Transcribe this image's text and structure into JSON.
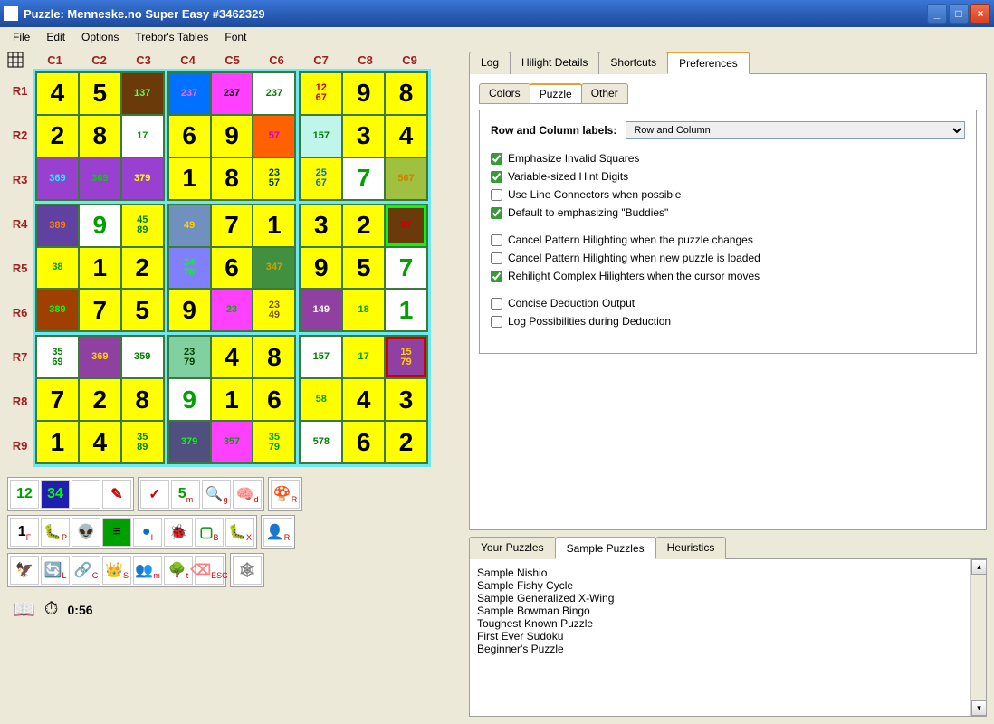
{
  "window": {
    "title": "Puzzle: Menneske.no Super Easy #3462329"
  },
  "menu": [
    "File",
    "Edit",
    "Options",
    "Trebor's Tables",
    "Font"
  ],
  "cols": [
    "C1",
    "C2",
    "C3",
    "C4",
    "C5",
    "C6",
    "C7",
    "C8",
    "C9"
  ],
  "rows": [
    "R1",
    "R2",
    "R3",
    "R4",
    "R5",
    "R6",
    "R7",
    "R8",
    "R9"
  ],
  "grid": [
    [
      {
        "t": "4",
        "bg": "#ffff00"
      },
      {
        "t": "5",
        "bg": "#ffff00"
      },
      {
        "t": "137",
        "bg": "#6a3a0a",
        "fg": "#5cff5c",
        "hint": true
      },
      {
        "t": "237",
        "bg": "#0070ff",
        "fg": "#ff60ff",
        "hint": true
      },
      {
        "t": "237",
        "bg": "#ff40ff",
        "fg": "#000",
        "hint": true
      },
      {
        "t": "237",
        "bg": "#ffffff",
        "fg": "#008000",
        "hint": true
      },
      {
        "t": "12\n67",
        "bg": "#ffff00",
        "fg": "#d00000",
        "hint": true
      },
      {
        "t": "9",
        "bg": "#ffff00"
      },
      {
        "t": "8",
        "bg": "#ffff00"
      }
    ],
    [
      {
        "t": "2",
        "bg": "#ffff00"
      },
      {
        "t": "8",
        "bg": "#ffff00"
      },
      {
        "t": "17",
        "bg": "#ffffff",
        "fg": "#00a000",
        "hint": true
      },
      {
        "t": "6",
        "bg": "#ffff00"
      },
      {
        "t": "9",
        "bg": "#ffff00"
      },
      {
        "t": "57",
        "bg": "#ff6000",
        "fg": "#d000d0",
        "hint": true
      },
      {
        "t": "157",
        "bg": "#c0f5ec",
        "fg": "#008000",
        "hint": true
      },
      {
        "t": "3",
        "bg": "#ffff00"
      },
      {
        "t": "4",
        "bg": "#ffff00"
      }
    ],
    [
      {
        "t": "369",
        "bg": "#9a40d0",
        "fg": "#00ffff",
        "hint": true
      },
      {
        "t": "369",
        "bg": "#9a40d0",
        "fg": "#00d000",
        "hint": true
      },
      {
        "t": "379",
        "bg": "#9a40d0",
        "fg": "#ffff00",
        "hint": true
      },
      {
        "t": "1",
        "bg": "#ffff00"
      },
      {
        "t": "8",
        "bg": "#ffff00"
      },
      {
        "t": "23\n57",
        "bg": "#ffff00",
        "fg": "#004000",
        "hint": true
      },
      {
        "t": "25\n67",
        "bg": "#ffff00",
        "fg": "#0070d0",
        "hint": true
      },
      {
        "t": "7",
        "bg": "#ffffff",
        "fg": "#00a000"
      },
      {
        "t": "567",
        "bg": "#a0c040",
        "fg": "#d08000",
        "hint": true
      }
    ],
    [
      {
        "t": "389",
        "bg": "#6040a0",
        "fg": "#ff8000",
        "hint": true
      },
      {
        "t": "9",
        "bg": "#ffffff",
        "fg": "#00a000"
      },
      {
        "t": "45\n89",
        "bg": "#ffff00",
        "fg": "#008000",
        "hint": true
      },
      {
        "t": "49",
        "bg": "#7090c0",
        "fg": "#ffd000",
        "hint": true
      },
      {
        "t": "7",
        "bg": "#ffff00"
      },
      {
        "t": "1",
        "bg": "#ffff00"
      },
      {
        "t": "3",
        "bg": "#ffff00"
      },
      {
        "t": "2",
        "bg": "#ffff00"
      },
      {
        "t": "67",
        "bg": "#6a3a0a",
        "fg": "#d00000",
        "hint": true,
        "accent": "#00ff00"
      }
    ],
    [
      {
        "t": "38",
        "bg": "#ffff00",
        "fg": "#00a000",
        "hint": true
      },
      {
        "t": "1",
        "bg": "#ffff00"
      },
      {
        "t": "2",
        "bg": "#ffff00"
      },
      {
        "t": "34\n78",
        "bg": "#8080ff",
        "fg": "#00ff00",
        "hint": true
      },
      {
        "t": "6",
        "bg": "#ffff00"
      },
      {
        "t": "347",
        "bg": "#409040",
        "fg": "#d0a000",
        "hint": true
      },
      {
        "t": "9",
        "bg": "#ffff00"
      },
      {
        "t": "5",
        "bg": "#ffff00"
      },
      {
        "t": "7",
        "bg": "#ffffff",
        "fg": "#00a000"
      }
    ],
    [
      {
        "t": "389",
        "bg": "#a04000",
        "fg": "#00ff00",
        "hint": true
      },
      {
        "t": "7",
        "bg": "#ffff00"
      },
      {
        "t": "5",
        "bg": "#ffff00"
      },
      {
        "t": "9",
        "bg": "#ffff00"
      },
      {
        "t": "23",
        "bg": "#ff40ff",
        "fg": "#00b000",
        "hint": true
      },
      {
        "t": "23\n49",
        "bg": "#ffff00",
        "fg": "#805000",
        "hint": true
      },
      {
        "t": "149",
        "bg": "#9040a0",
        "fg": "#ffffff",
        "hint": true
      },
      {
        "t": "18",
        "bg": "#ffff00",
        "fg": "#00a000",
        "hint": true
      },
      {
        "t": "1",
        "bg": "#ffffff",
        "fg": "#00a000"
      }
    ],
    [
      {
        "t": "35\n69",
        "bg": "#ffffff",
        "fg": "#008000",
        "hint": true
      },
      {
        "t": "369",
        "bg": "#9040a0",
        "fg": "#ffd000",
        "hint": true
      },
      {
        "t": "359",
        "bg": "#ffffff",
        "fg": "#008000",
        "hint": true
      },
      {
        "t": "23\n79",
        "bg": "#80d0a0",
        "fg": "#004000",
        "hint": true
      },
      {
        "t": "4",
        "bg": "#ffff00"
      },
      {
        "t": "8",
        "bg": "#ffff00"
      },
      {
        "t": "157",
        "bg": "#ffffff",
        "fg": "#008000",
        "hint": true
      },
      {
        "t": "17",
        "bg": "#ffff00",
        "fg": "#00a000",
        "hint": true
      },
      {
        "t": "15\n79",
        "bg": "#9040a0",
        "fg": "#ffd000",
        "hint": true,
        "accent": "#d00000"
      }
    ],
    [
      {
        "t": "7",
        "bg": "#ffff00"
      },
      {
        "t": "2",
        "bg": "#ffff00"
      },
      {
        "t": "8",
        "bg": "#ffff00"
      },
      {
        "t": "9",
        "bg": "#ffffff",
        "fg": "#00a000"
      },
      {
        "t": "1",
        "bg": "#ffff00"
      },
      {
        "t": "6",
        "bg": "#ffff00"
      },
      {
        "t": "58",
        "bg": "#ffff00",
        "fg": "#00a000",
        "hint": true
      },
      {
        "t": "4",
        "bg": "#ffff00"
      },
      {
        "t": "3",
        "bg": "#ffff00"
      }
    ],
    [
      {
        "t": "1",
        "bg": "#ffff00"
      },
      {
        "t": "4",
        "bg": "#ffff00"
      },
      {
        "t": "35\n89",
        "bg": "#ffff00",
        "fg": "#008000",
        "hint": true
      },
      {
        "t": "379",
        "bg": "#505080",
        "fg": "#00ff00",
        "hint": true
      },
      {
        "t": "357",
        "bg": "#ff40ff",
        "fg": "#00a000",
        "hint": true
      },
      {
        "t": "35\n79",
        "bg": "#ffff00",
        "fg": "#00a000",
        "hint": true
      },
      {
        "t": "578",
        "bg": "#ffffff",
        "fg": "#008000",
        "hint": true
      },
      {
        "t": "6",
        "bg": "#ffff00"
      },
      {
        "t": "2",
        "bg": "#ffff00"
      }
    ]
  ],
  "toolbar1": [
    {
      "txt": "12",
      "bg": "#ffffff",
      "fg": "#00a000"
    },
    {
      "txt": "34",
      "bg": "#2020b0",
      "fg": "#00ff00"
    },
    {
      "txt": "",
      "bg": "#ffffff"
    },
    {
      "txt": "✎",
      "bg": "#ffffff",
      "fg": "#d00000"
    }
  ],
  "toolbar1b": [
    {
      "txt": "✓",
      "fg": "#d00000"
    },
    {
      "txt": "5",
      "fg": "#00a000",
      "sub": "m"
    },
    {
      "txt": "🔍",
      "fg": "#d00000",
      "sub": "g"
    },
    {
      "txt": "🧠",
      "fg": "#e0a0b0",
      "sub": "d"
    }
  ],
  "toolbar1c": [
    {
      "txt": "🍄",
      "fg": "#3080d0",
      "sub": "R"
    }
  ],
  "toolbar2": [
    {
      "txt": "1",
      "sub": "F"
    },
    {
      "txt": "🐛",
      "fg": "#00a000",
      "sub": "P"
    },
    {
      "txt": "👽",
      "fg": "#00a000"
    },
    {
      "txt": "≡",
      "bg": "#00a000",
      "fg": "#000"
    },
    {
      "txt": "●",
      "fg": "#0070d0",
      "sub": "I"
    },
    {
      "txt": "🐞"
    },
    {
      "txt": "▢",
      "fg": "#00a000",
      "sub": "B"
    },
    {
      "txt": "🐛",
      "fg": "#a0a000",
      "sub": "X"
    }
  ],
  "toolbar2b": [
    {
      "txt": "👤",
      "sub": "R"
    }
  ],
  "toolbar3": [
    {
      "txt": "🦅",
      "fg": "#000"
    },
    {
      "txt": "🔄",
      "fg": "#d00000",
      "sub": "L"
    },
    {
      "txt": "🔗",
      "fg": "#808080",
      "sub": "C"
    },
    {
      "txt": "👑",
      "fg": "#d00000",
      "sub": "S"
    },
    {
      "txt": "👥",
      "sub": "m"
    },
    {
      "txt": "🌳",
      "fg": "#804000",
      "sub": "t"
    },
    {
      "txt": "⌫",
      "fg": "#ff8080",
      "sub": "ESC"
    }
  ],
  "toolbar3b": [
    {
      "txt": "🕸",
      "fg": "#808080"
    }
  ],
  "timer": "0:56",
  "topTabs": [
    "Log",
    "Hilight Details",
    "Shortcuts",
    "Preferences"
  ],
  "topTabsActive": 3,
  "prefTabs": [
    "Colors",
    "Puzzle",
    "Other"
  ],
  "prefTabsActive": 1,
  "rowColLabel": "Row and Column labels:",
  "rowColValue": "Row and Column",
  "checkboxes": [
    {
      "label": "Emphasize Invalid Squares",
      "checked": true
    },
    {
      "label": "Variable-sized Hint Digits",
      "checked": true
    },
    {
      "label": "Use Line Connectors when possible",
      "checked": false
    },
    {
      "label": "Default to emphasizing \"Buddies\"",
      "checked": true
    }
  ],
  "checkboxes2": [
    {
      "label": "Cancel Pattern Hilighting when the puzzle changes",
      "checked": false
    },
    {
      "label": "Cancel Pattern Hilighting when new puzzle is loaded",
      "checked": false
    },
    {
      "label": "Rehilight Complex Hilighters when the cursor moves",
      "checked": true
    }
  ],
  "checkboxes3": [
    {
      "label": "Concise Deduction Output",
      "checked": false
    },
    {
      "label": "Log Possibilities during Deduction",
      "checked": false
    }
  ],
  "bottomTabs": [
    "Your Puzzles",
    "Sample Puzzles",
    "Heuristics"
  ],
  "bottomTabsActive": 1,
  "samples": [
    "Sample Nishio",
    "Sample Fishy Cycle",
    "Sample Generalized X-Wing",
    "Sample Bowman Bingo",
    "Toughest Known Puzzle",
    "First Ever Sudoku",
    "Beginner's Puzzle"
  ]
}
